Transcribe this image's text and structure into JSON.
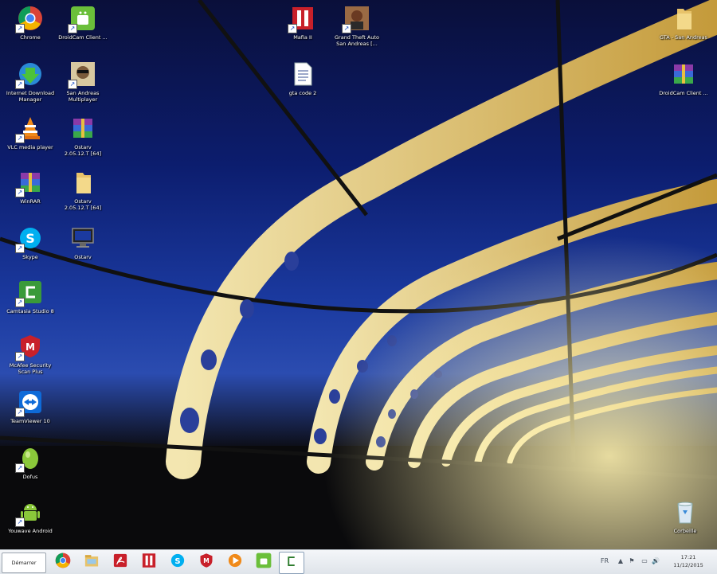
{
  "desktop": {
    "icons": [
      {
        "label": "Chrome",
        "icon": "chrome-icon"
      },
      {
        "label": "DroidCam Client ...",
        "icon": "droidcam-icon"
      },
      {
        "label": "Mafia II",
        "icon": "mafia-icon"
      },
      {
        "label": "Grand Theft Auto\nSan Andreas [...",
        "icon": "gta-icon"
      },
      {
        "label": "GTA - San Andreas",
        "icon": "folder-icon"
      },
      {
        "label": "Internet Download\nManager",
        "icon": "idm-icon"
      },
      {
        "label": "San Andreas\nMultiplayer",
        "icon": "samp-icon"
      },
      {
        "label": "gta code 2",
        "icon": "text-file-icon"
      },
      {
        "label": "DroidCam Client ...",
        "icon": "winrar-icon"
      },
      {
        "label": "VLC media player",
        "icon": "vlc-icon"
      },
      {
        "label": "Ostarv\n2.05.12.T [64]",
        "icon": "winrar-icon"
      },
      {
        "label": "WinRAR",
        "icon": "winrar-icon"
      },
      {
        "label": "Ostarv\n2.05.12.T [64]",
        "icon": "folder-icon"
      },
      {
        "label": "Skype",
        "icon": "skype-icon"
      },
      {
        "label": "Ostarv",
        "icon": "computer-icon"
      },
      {
        "label": "Camtasia Studio 8",
        "icon": "camtasia-icon"
      },
      {
        "label": "McAfee Security\nScan Plus",
        "icon": "mcafee-icon"
      },
      {
        "label": "TeamViewer 10",
        "icon": "teamviewer-icon"
      },
      {
        "label": "Dofus",
        "icon": "dofus-icon"
      },
      {
        "label": "Youwave Android",
        "icon": "android-icon"
      },
      {
        "label": "Corbeille",
        "icon": "recycle-bin-icon"
      }
    ]
  },
  "taskbar": {
    "start_label": "Démarrer",
    "pinned": [
      {
        "icon": "chrome-icon"
      },
      {
        "icon": "explorer-icon"
      },
      {
        "icon": "acrobat-icon"
      },
      {
        "icon": "mafia-icon"
      },
      {
        "icon": "skype-icon"
      },
      {
        "icon": "mcafee-icon"
      },
      {
        "icon": "media-player-icon"
      },
      {
        "icon": "droidcam-icon"
      },
      {
        "icon": "camtasia-icon",
        "active": true
      }
    ],
    "tray": [
      "FR",
      "▲",
      "⚑",
      "▭",
      "🔊"
    ],
    "clock": {
      "time": "17:21",
      "date": "11/12/2015"
    }
  },
  "colors": {
    "taskbar_bg": "#e6eaef",
    "sky_top": "#0a0f3a",
    "sky_mid": "#1b3aa0",
    "arch_gold": "#e8c66a"
  }
}
